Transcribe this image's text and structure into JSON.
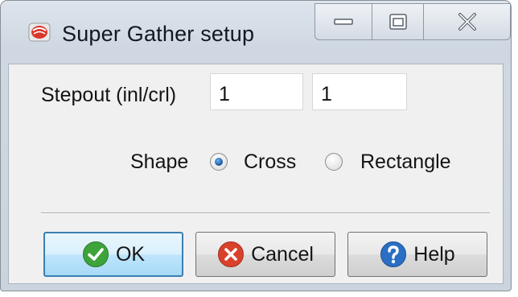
{
  "window": {
    "title": "Super Gather setup",
    "icon": "app-logo-icon",
    "caption_buttons": [
      "minimize-icon",
      "maximize-icon",
      "close-icon"
    ]
  },
  "stepout": {
    "label": "Stepout (inl/crl)",
    "inline_value": "1",
    "crossline_value": "1"
  },
  "shape": {
    "label": "Shape",
    "options": [
      {
        "label": "Cross",
        "selected": true
      },
      {
        "label": "Rectangle",
        "selected": false
      }
    ]
  },
  "buttons": {
    "ok": {
      "label": "OK",
      "icon": "check-icon",
      "icon_color": "#3ea33a"
    },
    "cancel": {
      "label": "Cancel",
      "icon": "x-circle-icon",
      "icon_color": "#d9412b"
    },
    "help": {
      "label": "Help",
      "icon": "question-icon",
      "icon_color": "#2a6fc4"
    }
  },
  "colors": {
    "default_button_border": "#3c7fb1",
    "radio_selected": "#1f5fa8"
  }
}
